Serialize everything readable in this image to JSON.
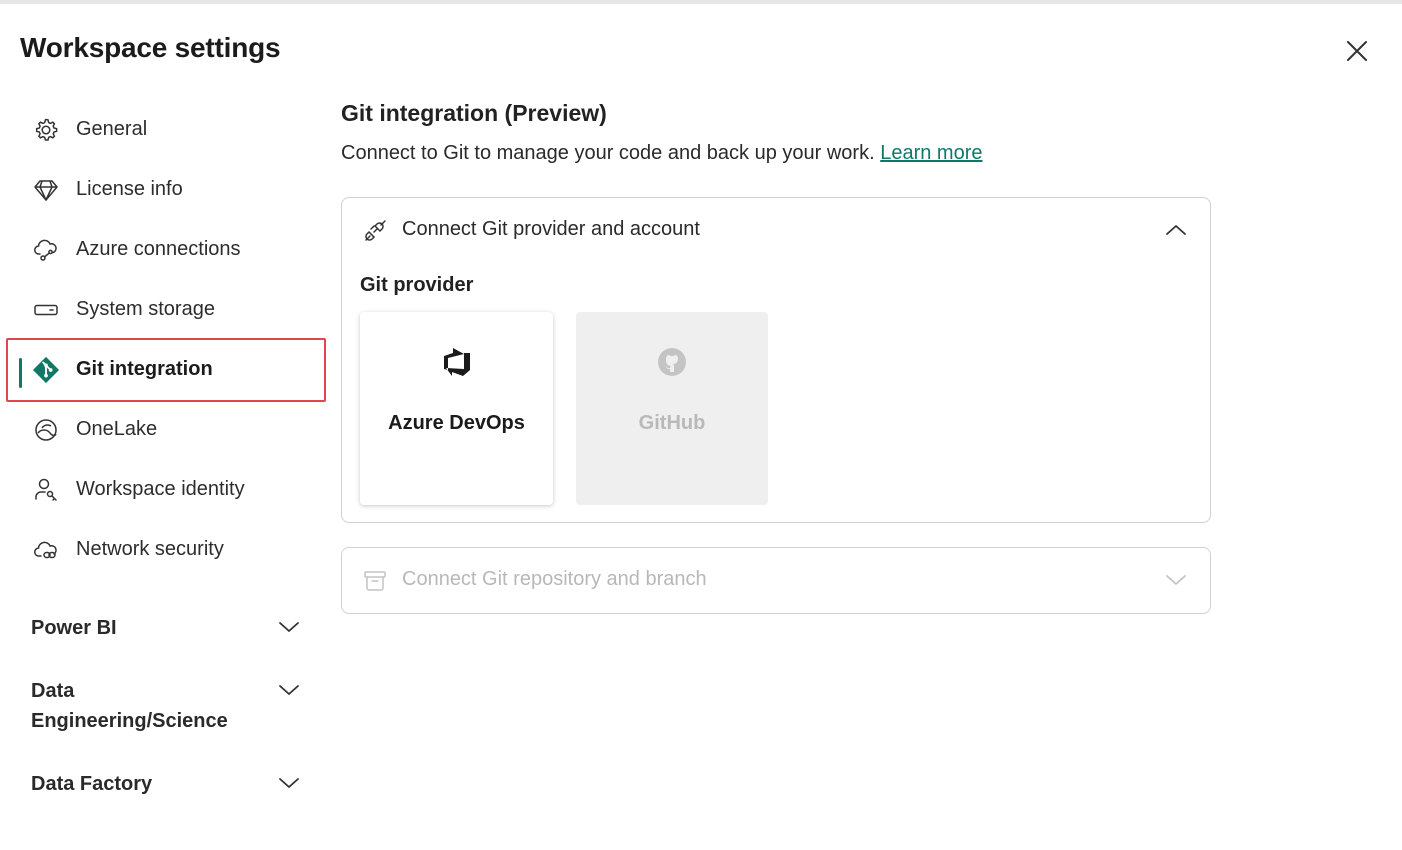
{
  "dialog": {
    "title": "Workspace settings"
  },
  "sidebar": {
    "items": [
      {
        "label": "General",
        "icon": "gear-icon"
      },
      {
        "label": "License info",
        "icon": "diamond-icon"
      },
      {
        "label": "Azure connections",
        "icon": "cloud-connection-icon"
      },
      {
        "label": "System storage",
        "icon": "storage-icon"
      },
      {
        "label": "Git integration",
        "icon": "git-icon",
        "active": true
      },
      {
        "label": "OneLake",
        "icon": "onelake-icon"
      },
      {
        "label": "Workspace identity",
        "icon": "person-key-icon"
      },
      {
        "label": "Network security",
        "icon": "cloud-link-icon"
      }
    ],
    "sections": [
      {
        "label": "Power BI"
      },
      {
        "label": "Data Engineering/Science"
      },
      {
        "label": "Data Factory"
      }
    ]
  },
  "main": {
    "heading": "Git integration (Preview)",
    "description": "Connect to Git to manage your code and back up your work. ",
    "learn_more": "Learn more",
    "panel_provider": {
      "title": "Connect Git provider and account",
      "provider_label": "Git provider",
      "providers": [
        {
          "label": "Azure DevOps",
          "icon": "azure-devops-icon",
          "enabled": true
        },
        {
          "label": "GitHub",
          "icon": "github-icon",
          "enabled": false
        }
      ]
    },
    "panel_repo": {
      "title": "Connect Git repository and branch"
    }
  },
  "colors": {
    "accent": "#117865",
    "highlight_border": "#e0474c",
    "disabled_text": "#b8b8b8"
  }
}
